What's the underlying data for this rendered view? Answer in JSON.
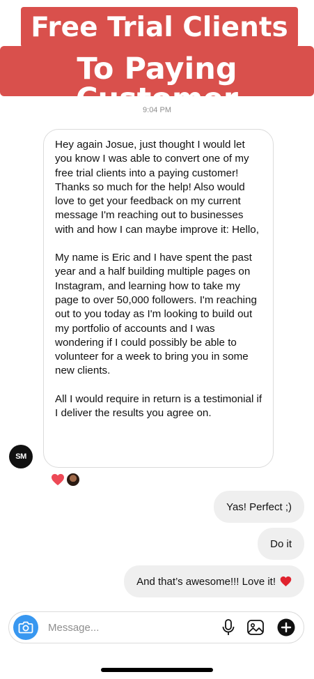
{
  "banner": {
    "line1": "Free Trial Clients",
    "line2": "To Paying Customer",
    "color": "#d9504c"
  },
  "thread": {
    "timestamp": "9:04 PM",
    "incoming": {
      "sender_initials": "SM",
      "paragraphs": [
        "Hey again Josue, just thought I would let you know I was able to convert one of my free trial clients into a paying customer! Thanks so much for the help! Also would love to get your feedback on my current message I'm reaching out to businesses with and how I can maybe improve it: Hello,",
        "My name is Eric and I have spent the past year and a half building multiple pages on Instagram, and learning how to take my page to over 50,000 followers. I'm reaching out to you today as I'm looking to build out my portfolio of accounts and I was wondering if I could possibly be able to volunteer for a week to bring you in some new clients.",
        "All I would require in return is a testimonial if I deliver the results you agree on."
      ],
      "reaction": "heart-icon"
    },
    "outgoing": [
      {
        "text": "Yas! Perfect ;)"
      },
      {
        "text": "Do it"
      },
      {
        "text": "And that’s awesome!!! Love it!",
        "emoji": "heart-icon"
      }
    ]
  },
  "composer": {
    "placeholder": "Message...",
    "icons": [
      "camera-icon",
      "microphone-icon",
      "gallery-icon",
      "plus-icon"
    ],
    "accent": "#3897f0"
  }
}
